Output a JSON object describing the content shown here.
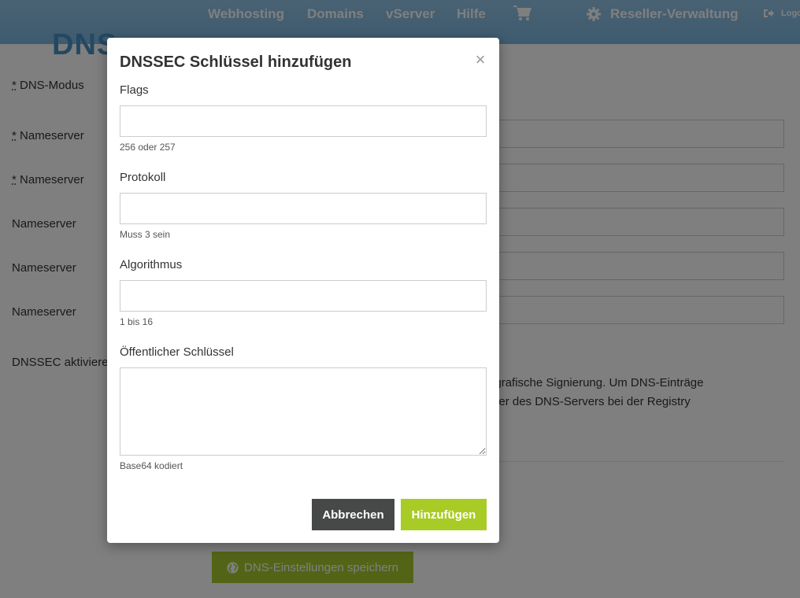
{
  "topnav": {
    "links": [
      "Webhosting",
      "Domains",
      "vServer",
      "Hilfe"
    ],
    "cart_icon": "shopping-cart-icon",
    "reseller_label": "Reseller-Verwaltung",
    "reseller_icon": "gear-icon",
    "logout_label": "Logo",
    "logout_icon": "sign-out-icon"
  },
  "page": {
    "heading": "DNS"
  },
  "form": {
    "labels": {
      "dns_mode": "DNS-Modus",
      "ns1": "Nameserver",
      "ns2": "Nameserver",
      "ns3": "Nameserver",
      "ns4": "Nameserver",
      "ns5": "Nameserver",
      "dnssec": "DNSSEC aktivieren"
    },
    "required_marker": "*",
    "dnssec_text_line1": "yptografische Signierung. Um DNS-Einträge",
    "dnssec_text_line2": "ameter des DNS-Servers bei der Registry",
    "save_label": "DNS-Einstellungen speichern",
    "save_icon": "globe-icon"
  },
  "modal": {
    "title": "DNSSEC Schlüssel hinzufügen",
    "close_symbol": "×",
    "fields": {
      "flags": {
        "label": "Flags",
        "value": "",
        "help": "256 oder 257"
      },
      "protocol": {
        "label": "Protokoll",
        "value": "",
        "help": "Muss 3 sein"
      },
      "algorithm": {
        "label": "Algorithmus",
        "value": "",
        "help": "1 bis 16"
      },
      "public_key": {
        "label": "Öffentlicher Schlüssel",
        "value": "",
        "help": "Base64 kodiert"
      }
    },
    "cancel_label": "Abbrechen",
    "add_label": "Hinzufügen"
  },
  "colors": {
    "nav_bg": "#7db6de",
    "accent_green": "#a9cb26",
    "cancel_dark": "#474949"
  }
}
